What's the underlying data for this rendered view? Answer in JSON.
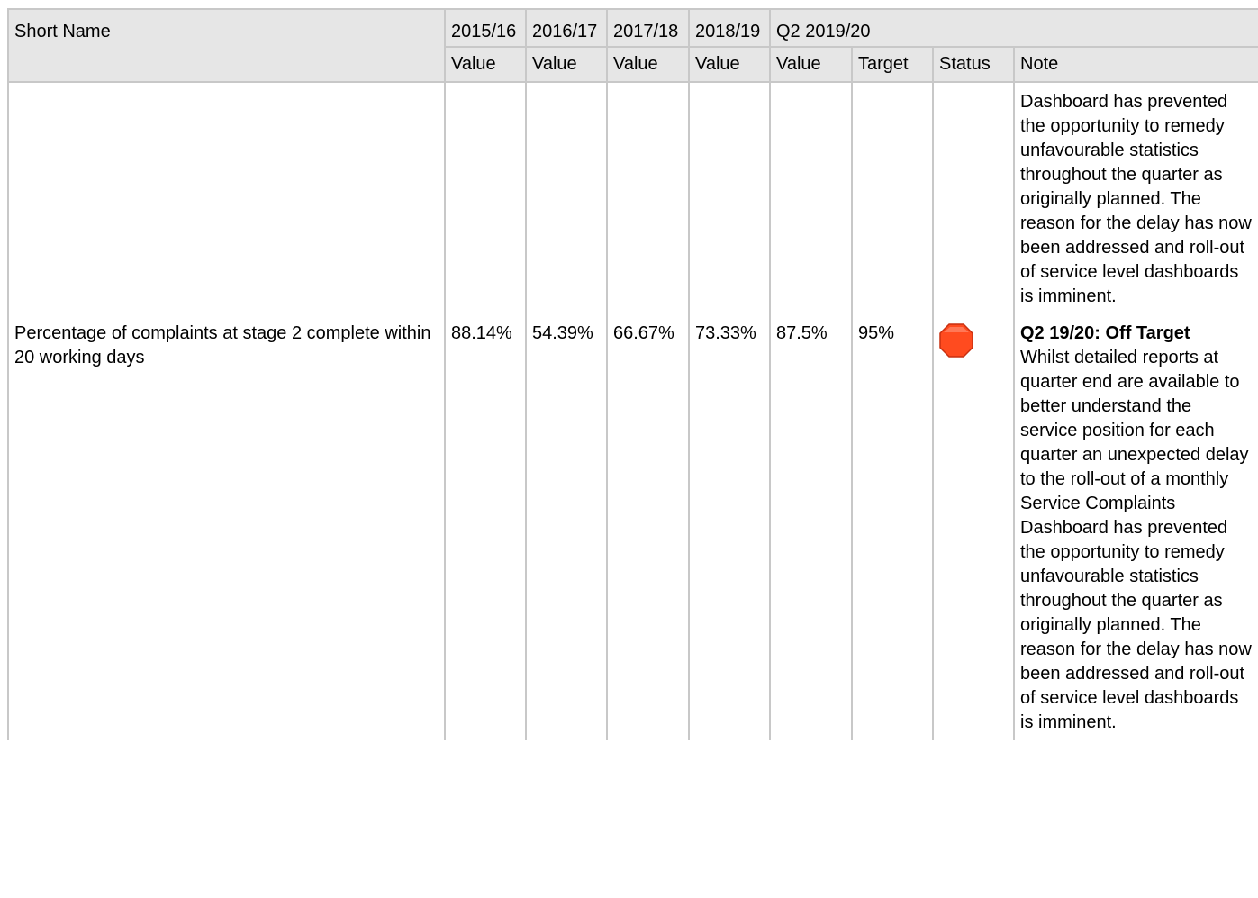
{
  "header": {
    "short_name": "Short Name",
    "years": [
      "2015/16",
      "2016/17",
      "2017/18",
      "2018/19"
    ],
    "quarter": "Q2 2019/20",
    "sub": {
      "value": "Value",
      "target": "Target",
      "status": "Status",
      "note": "Note"
    }
  },
  "continued_row": {
    "note": "Dashboard has prevented the opportunity to remedy unfavourable statistics throughout the quarter as originally planned. The reason for the delay has now been addressed and roll-out of service level dashboards is imminent."
  },
  "row": {
    "short_name": "Percentage of complaints at stage 2 complete within 20 working days",
    "values": [
      "88.14%",
      "54.39%",
      "66.67%",
      "73.33%"
    ],
    "q_value": "87.5%",
    "target": "95%",
    "status": "off-target",
    "status_color": "#ff4b1f",
    "note_heading": "Q2 19/20: Off Target",
    "note_body": "Whilst detailed reports at quarter end are available to better understand the service position for each quarter an unexpected delay to the roll-out of a monthly Service Complaints Dashboard has prevented the opportunity to remedy unfavourable statistics throughout the quarter as originally planned. The reason for the delay has now been addressed and roll-out of service level dashboards is imminent."
  },
  "icons": {
    "status_icon": "red-octagon-icon"
  }
}
